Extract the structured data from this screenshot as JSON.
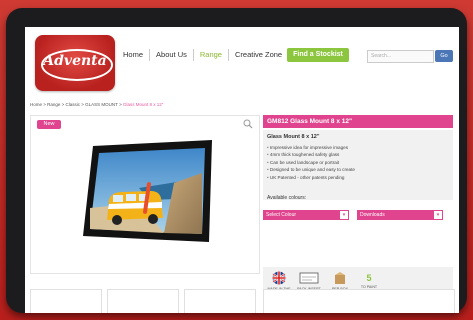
{
  "brand": {
    "name": "Adventa"
  },
  "nav": {
    "items": [
      {
        "label": "Home"
      },
      {
        "label": "About Us"
      },
      {
        "label": "Range"
      },
      {
        "label": "Creative Zone"
      }
    ],
    "find_stockist": "Find a Stockist",
    "search_placeholder": "Search...",
    "go_label": "Go"
  },
  "breadcrumb": {
    "trail": "Home > Range > Classic > GLASS MOUNT >",
    "current": "Glass Mount 8 x 12\""
  },
  "product": {
    "badge": "New",
    "title": "GM812 Glass Mount 8 x 12\"",
    "spec_title": "Glass Mount 8 x 12\"",
    "features": [
      "Impressive idea for impressive images",
      "4mm thick toughened safety glass",
      "Can be used landscape or portrait",
      "Designed to be unique and easy to create",
      "UK Patented - other patents pending"
    ],
    "colours_label": "Available colours:",
    "select_colour": "Select Colour",
    "downloads": "Downloads",
    "icons": [
      {
        "icon": "uk-flag-icon",
        "label": "MADE IN THE UK"
      },
      {
        "icon": "pack-box-icon",
        "label": "PACK INSERT"
      },
      {
        "icon": "carton-icon",
        "label": "PER BOX"
      },
      {
        "icon": "count-icon",
        "value": "5",
        "label": "TO PAINT"
      }
    ]
  },
  "colors": {
    "accent": "#e0448e",
    "nav_active": "#8ab82e",
    "find_btn": "#8cc63f",
    "go_btn": "#4b77b6",
    "brand_red": "#c62a26"
  }
}
